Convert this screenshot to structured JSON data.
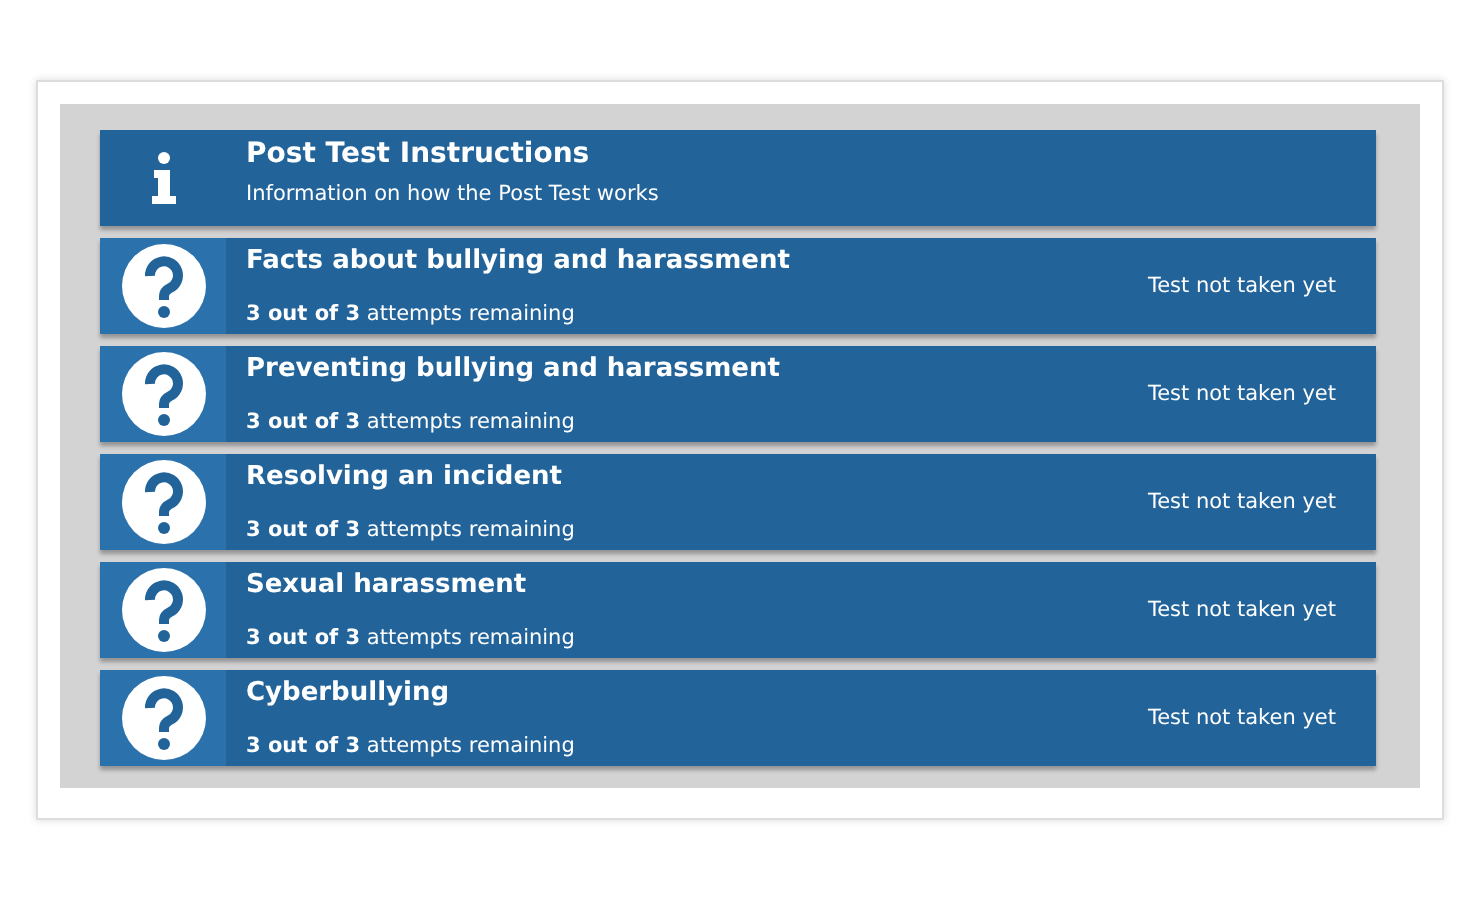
{
  "items": [
    {
      "kind": "info",
      "title": "Post Test Instructions",
      "subtitle": "Information on how the Post Test works"
    },
    {
      "kind": "quiz",
      "title": "Facts about bullying and harassment",
      "attempts": "**3 out of 3** attempts remaining",
      "status": "Test not taken yet"
    },
    {
      "kind": "quiz",
      "title": "Preventing bullying and harassment",
      "attempts": "**3 out of 3** attempts remaining",
      "status": "Test not taken yet"
    },
    {
      "kind": "quiz",
      "title": "Resolving an incident",
      "attempts": "**3 out of 3** attempts remaining",
      "status": "Test not taken yet"
    },
    {
      "kind": "quiz",
      "title": "Sexual harassment",
      "attempts": "**3 out of 3** attempts remaining",
      "status": "Test not taken yet"
    },
    {
      "kind": "quiz",
      "title": "Cyberbullying",
      "attempts": "**3 out of 3** attempts remaining",
      "status": "Test not taken yet"
    }
  ]
}
